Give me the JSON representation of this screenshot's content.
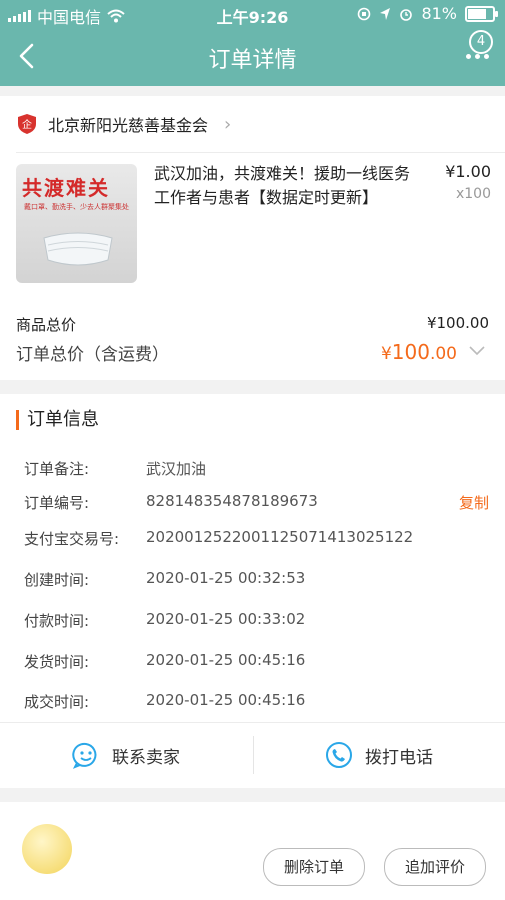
{
  "status_bar": {
    "carrier": "中国电信",
    "time": "上午9:26",
    "battery": "81%",
    "battery_level": 0.81
  },
  "nav": {
    "title": "订单详情",
    "badge_count": "4"
  },
  "seller": {
    "name": "北京新阳光慈善基金会"
  },
  "product": {
    "image_title": "共渡难关",
    "image_subtitle": "戴口罩、勤洗手、少去人群聚集处",
    "name": "武汉加油，共渡难关！援助一线医务工作者与患者【数据定时更新】",
    "price": "¥1.00",
    "quantity": "x100"
  },
  "totals": {
    "subtotal_label": "商品总价",
    "subtotal_value": "¥100.00",
    "total_label": "订单总价（含运费）",
    "total_currency": "¥",
    "total_integer": "100",
    "total_decimal": ".00"
  },
  "order_info": {
    "section_title": "订单信息",
    "rows": [
      {
        "label": "订单备注:",
        "value": "武汉加油"
      },
      {
        "label": "订单编号:",
        "value": "828148354878189673"
      },
      {
        "label": "支付宝交易号:",
        "value": "2020012522001125071413025122"
      },
      {
        "label": "创建时间:",
        "value": "2020-01-25 00:32:53"
      },
      {
        "label": "付款时间:",
        "value": "2020-01-25 00:33:02"
      },
      {
        "label": "发货时间:",
        "value": "2020-01-25 00:45:16"
      },
      {
        "label": "成交时间:",
        "value": "2020-01-25 00:45:16"
      }
    ],
    "copy_label": "复制"
  },
  "actions": {
    "contact_seller": "联系卖家",
    "call_phone": "拨打电话",
    "delete_order": "删除订单",
    "add_review": "追加评价"
  },
  "colors": {
    "header": "#6ab7ad",
    "accent": "#f46a1b",
    "icon_blue": "#2aa7e8"
  },
  "icons": {
    "back": "chevron-left-icon",
    "more": "more-dots-icon",
    "seller_logo": "foundation-logo-icon",
    "chevron": "chevron-right-icon",
    "expand": "chevron-down-icon",
    "contact": "chat-smile-icon",
    "phone": "phone-icon",
    "wifi": "wifi-icon",
    "battery": "battery-icon"
  }
}
